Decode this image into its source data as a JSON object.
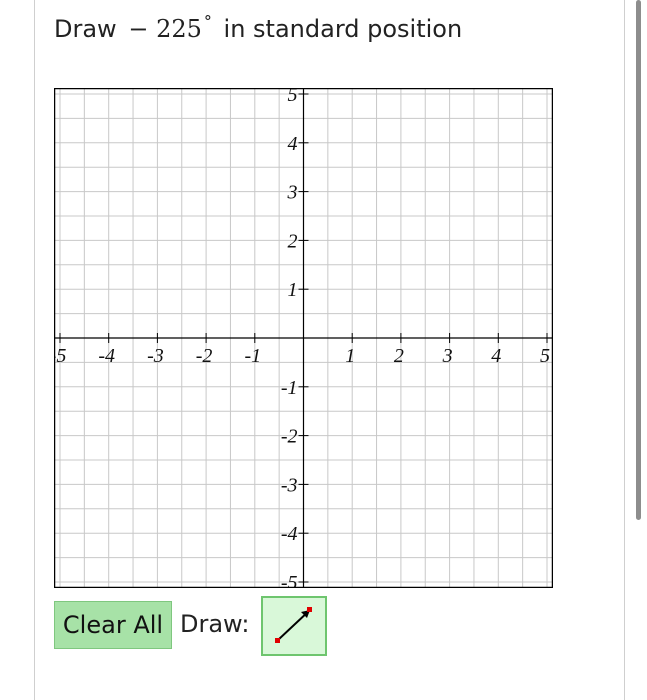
{
  "question": {
    "prefix": "Draw",
    "math_sign": "−",
    "math_value": "225",
    "degree_symbol": "°",
    "suffix": "in standard position"
  },
  "graph": {
    "x_range": [
      -5,
      5
    ],
    "y_range": [
      -5,
      5
    ],
    "x_tick_labels": [
      "-5",
      "-4",
      "-3",
      "-2",
      "-1",
      "1",
      "2",
      "3",
      "4",
      "5"
    ],
    "y_tick_labels": [
      "5",
      "4",
      "3",
      "2",
      "1",
      "-1",
      "-2",
      "-3",
      "-4",
      "-5"
    ],
    "grid_step": 0.5,
    "grid_color": "#c8c8c8",
    "axis_color": "#000000"
  },
  "controls": {
    "clear_all_label": "Clear All",
    "draw_label": "Draw:",
    "tool_icon": "line-segment-icon"
  },
  "colors": {
    "button_green": "#a7e2a7",
    "tool_bg": "#d9f8d9",
    "tool_border": "#6ec56e",
    "endpoint_red": "#e00000"
  }
}
